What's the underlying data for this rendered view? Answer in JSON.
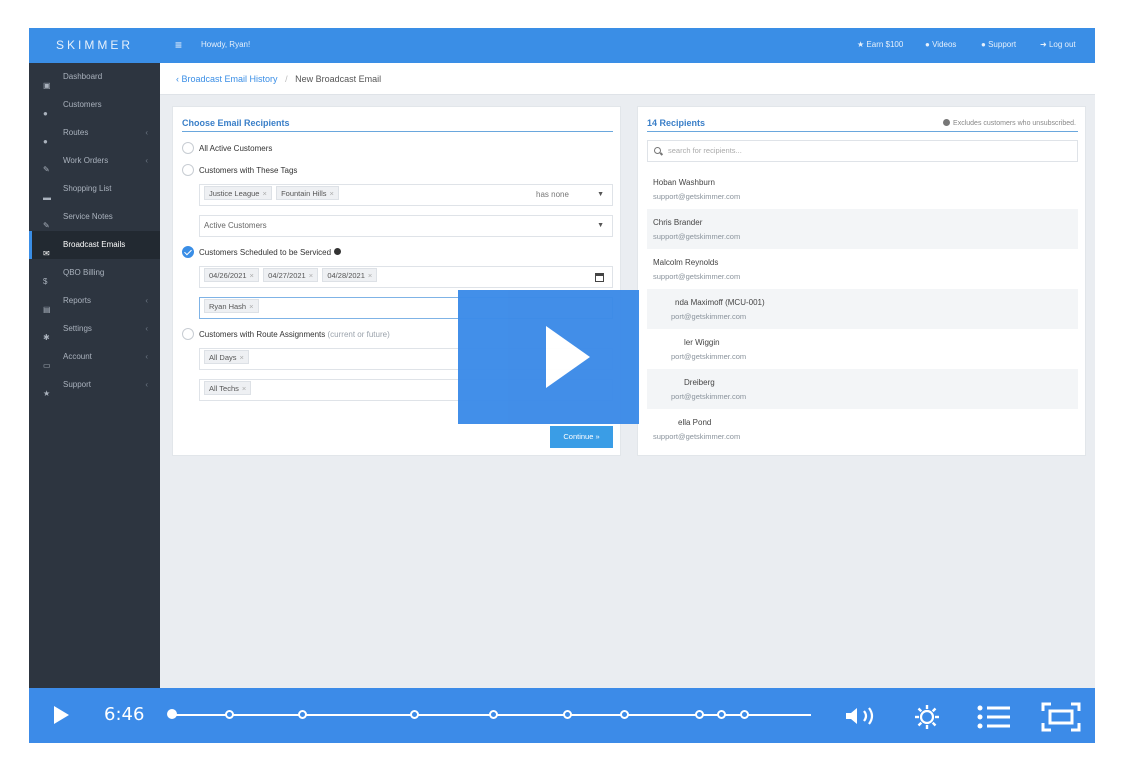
{
  "topbar": {
    "brand": "SKIMMER",
    "greeting": "Howdy, Ryan!",
    "links": {
      "earn": "Earn $100",
      "videos": "Videos",
      "support": "Support",
      "logout": "Log out"
    }
  },
  "sidebar": {
    "items": [
      {
        "label": "Dashboard",
        "icon": "dashboard-icon"
      },
      {
        "label": "Customers",
        "icon": "users-icon"
      },
      {
        "label": "Routes",
        "icon": "map-marker-icon"
      },
      {
        "label": "Work Orders",
        "icon": "wrench-icon"
      },
      {
        "label": "Shopping List",
        "icon": "cart-icon"
      },
      {
        "label": "Service Notes",
        "icon": "edit-icon"
      },
      {
        "label": "Broadcast Emails",
        "icon": "envelope-icon"
      },
      {
        "label": "QBO Billing",
        "icon": "dollar-icon"
      },
      {
        "label": "Reports",
        "icon": "print-icon"
      },
      {
        "label": "Settings",
        "icon": "gear-icon"
      },
      {
        "label": "Account",
        "icon": "card-icon"
      },
      {
        "label": "Support",
        "icon": "star-icon"
      }
    ],
    "active": "Broadcast Emails"
  },
  "breadcrumb": {
    "parent": "Broadcast Email History",
    "current": "New Broadcast Email"
  },
  "left_panel": {
    "title": "Choose Email Recipients",
    "options": {
      "all_active": "All Active Customers",
      "with_tags": "Customers with These Tags",
      "scheduled": "Customers Scheduled to be Serviced",
      "route_assign": "Customers with Route Assignments",
      "route_assign_note": "(current or future)"
    },
    "tags": [
      "Justice League",
      "Fountain Hills"
    ],
    "tags_mode": "has none",
    "status_filter": "Active Customers",
    "dates": [
      "04/26/2021",
      "04/27/2021",
      "04/28/2021"
    ],
    "tech_tag": "Ryan Hash",
    "days_tag": "All Days",
    "techs_tag": "All Techs",
    "continue_label": "Continue »"
  },
  "right_panel": {
    "title": "14 Recipients",
    "note": "Excludes customers who unsubscribed.",
    "search_placeholder": "search for recipients...",
    "recipients": [
      {
        "name": "Hoban Washburn",
        "email": "support@getskimmer.com"
      },
      {
        "name": "Chris Brander",
        "email": "support@getskimmer.com"
      },
      {
        "name": "Malcolm Reynolds",
        "email": "support@getskimmer.com"
      },
      {
        "name": "nda Maximoff (MCU-001)",
        "email": "port@getskimmer.com"
      },
      {
        "name": "ler Wiggin",
        "email": "port@getskimmer.com"
      },
      {
        "name": "Dreiberg",
        "email": "port@getskimmer.com"
      },
      {
        "name": "ella Pond",
        "email": "support@getskimmer.com"
      }
    ]
  },
  "video": {
    "time": "6:46",
    "progress": 0.0
  },
  "colors": {
    "accent": "#3a8ee6",
    "sidebar": "#2d3540"
  }
}
